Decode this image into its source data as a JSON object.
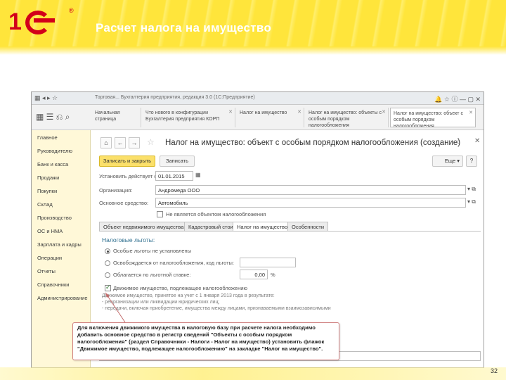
{
  "slide": {
    "title": "Расчет налога на имущество",
    "page_number": "32",
    "logo_text": "1С"
  },
  "window": {
    "title": "Торговая... Бухгалтерия предприятия, редакция 3.0 (1С:Предприятие)"
  },
  "tabs_top": [
    {
      "label": "Начальная страница"
    },
    {
      "label": "Что нового в конфигурации Бухгалтерия предприятия КОРП"
    },
    {
      "label": "Налог на имущество"
    },
    {
      "label": "Налог на имущество: объекты с особым порядком налогообложения"
    },
    {
      "label": "Налог на имущество: объект с особым порядком налогообложения"
    }
  ],
  "sidebar": {
    "items": [
      {
        "label": "Главное"
      },
      {
        "label": "Руководителю"
      },
      {
        "label": "Банк и касса"
      },
      {
        "label": "Продажи"
      },
      {
        "label": "Покупки"
      },
      {
        "label": "Склад"
      },
      {
        "label": "Производство"
      },
      {
        "label": "ОС и НМА"
      },
      {
        "label": "Зарплата и кадры"
      },
      {
        "label": "Операции"
      },
      {
        "label": "Отчеты"
      },
      {
        "label": "Справочники"
      },
      {
        "label": "Администрирование"
      }
    ]
  },
  "form": {
    "title": "Налог на имущество: объект с особым порядком налогообложения (создание)",
    "save_close_label": "Записать и закрыть",
    "write_label": "Записать",
    "more_label": "Еще",
    "help_label": "?",
    "date_label": "Установить действует с:",
    "date_value": "01.01.2015",
    "org_label": "Организация:",
    "org_value": "Андромеда ООО",
    "asset_label": "Основное средство:",
    "asset_value": "Автомобиль",
    "not_taxable_label": "Не является объектом налогообложения",
    "tabs": [
      {
        "label": "Объект недвижимого имущества"
      },
      {
        "label": "Кадастровый стоимость"
      },
      {
        "label": "Налог на имущество"
      },
      {
        "label": "Особенности"
      }
    ],
    "group_title": "Налоговые льготы:",
    "radio_options": [
      {
        "label": "Особые льготы не установлены"
      },
      {
        "label": "Освобождается от налогообложения, код льготы:"
      },
      {
        "label": "Облагается по льготной ставке:"
      }
    ],
    "rate_value": "0,00",
    "rate_unit": "%",
    "movable_label": "Движимое имущество, подлежащее налогообложению",
    "hints": [
      "Движимое имущество, принятое на учет с 1 января 2013 года в результате:",
      "- реорганизации или ликвидации юридических лиц;",
      "- передачи, включая приобретение, имущества между лицами, признаваемыми взаимозависимыми"
    ]
  },
  "callout": {
    "text": "Для включения движимого имущества в налоговую базу при расчете налога необходимо добавить основное средство в регистр сведений \"Объекты с особым порядком налогообложения\" (раздел Справочники - Налоги - Налог на имущество) установить флажок \"Движимое имущество, подлежащее налогообложению\" на закладке \"Налог на имущество\"."
  },
  "colors": {
    "header_yellow": "#ffe53b",
    "logo_red": "#d2001a",
    "save_button": "#fbe06a",
    "sidebar_bg": "#fff8d8",
    "group_title": "#2f6f8f"
  },
  "icons": {
    "back": "arrow-left-icon",
    "forward": "arrow-right-icon",
    "home": "home-icon",
    "favorite": "star-icon",
    "calendar": "calendar-icon",
    "dropdown": "chevron-down-icon",
    "close": "close-icon",
    "menu": "more-vertical-icon"
  }
}
